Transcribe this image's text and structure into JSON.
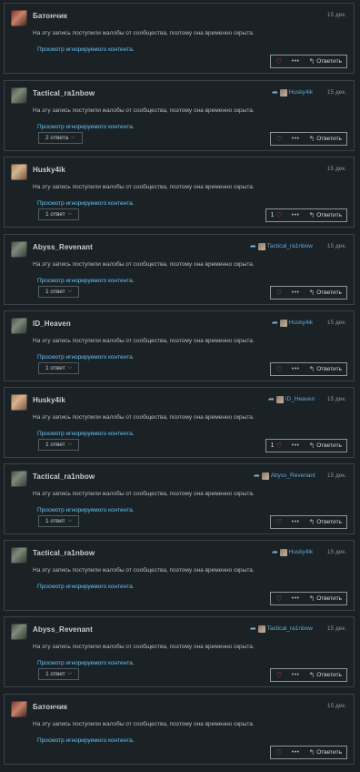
{
  "hidden_message": "На эту запись поступили жалобы от сообщества, поэтому она временно скрыта.",
  "view_link": "Просмотр игнорируемого контента.",
  "reply_label": "Ответить",
  "accent": "#66c0f4",
  "comments": [
    {
      "author": "Батончик",
      "date": "15 дек.",
      "reply_to": "",
      "replies": "",
      "likes": ""
    },
    {
      "author": "Tactical_ra1nbow",
      "date": "15 дек.",
      "reply_to": "Husky4ik",
      "replies": "2 ответа",
      "likes": ""
    },
    {
      "author": "Husky4ik",
      "date": "15 дек.",
      "reply_to": "",
      "replies": "1 ответ",
      "likes": "1"
    },
    {
      "author": "Abyss_Revenant",
      "date": "15 дек.",
      "reply_to": "Tactical_ra1nbow",
      "replies": "1 ответ",
      "likes": ""
    },
    {
      "author": "ID_Heaven",
      "date": "15 дек.",
      "reply_to": "Husky4ik",
      "replies": "1 ответ",
      "likes": ""
    },
    {
      "author": "Husky4ik",
      "date": "15 дек.",
      "reply_to": "ID_Heaven",
      "replies": "1 ответ",
      "likes": "1"
    },
    {
      "author": "Tactical_ra1nbow",
      "date": "15 дек.",
      "reply_to": "Abyss_Revenant",
      "replies": "1 ответ",
      "likes": ""
    },
    {
      "author": "Tactical_ra1nbow",
      "date": "15 дек.",
      "reply_to": "Husky4ik",
      "replies": "",
      "likes": ""
    },
    {
      "author": "Abyss_Revenant",
      "date": "15 дек.",
      "reply_to": "Tactical_ra1nbow",
      "replies": "1 ответ",
      "likes": ""
    },
    {
      "author": "Батончик",
      "date": "15 дек.",
      "reply_to": "",
      "replies": "",
      "likes": ""
    }
  ]
}
